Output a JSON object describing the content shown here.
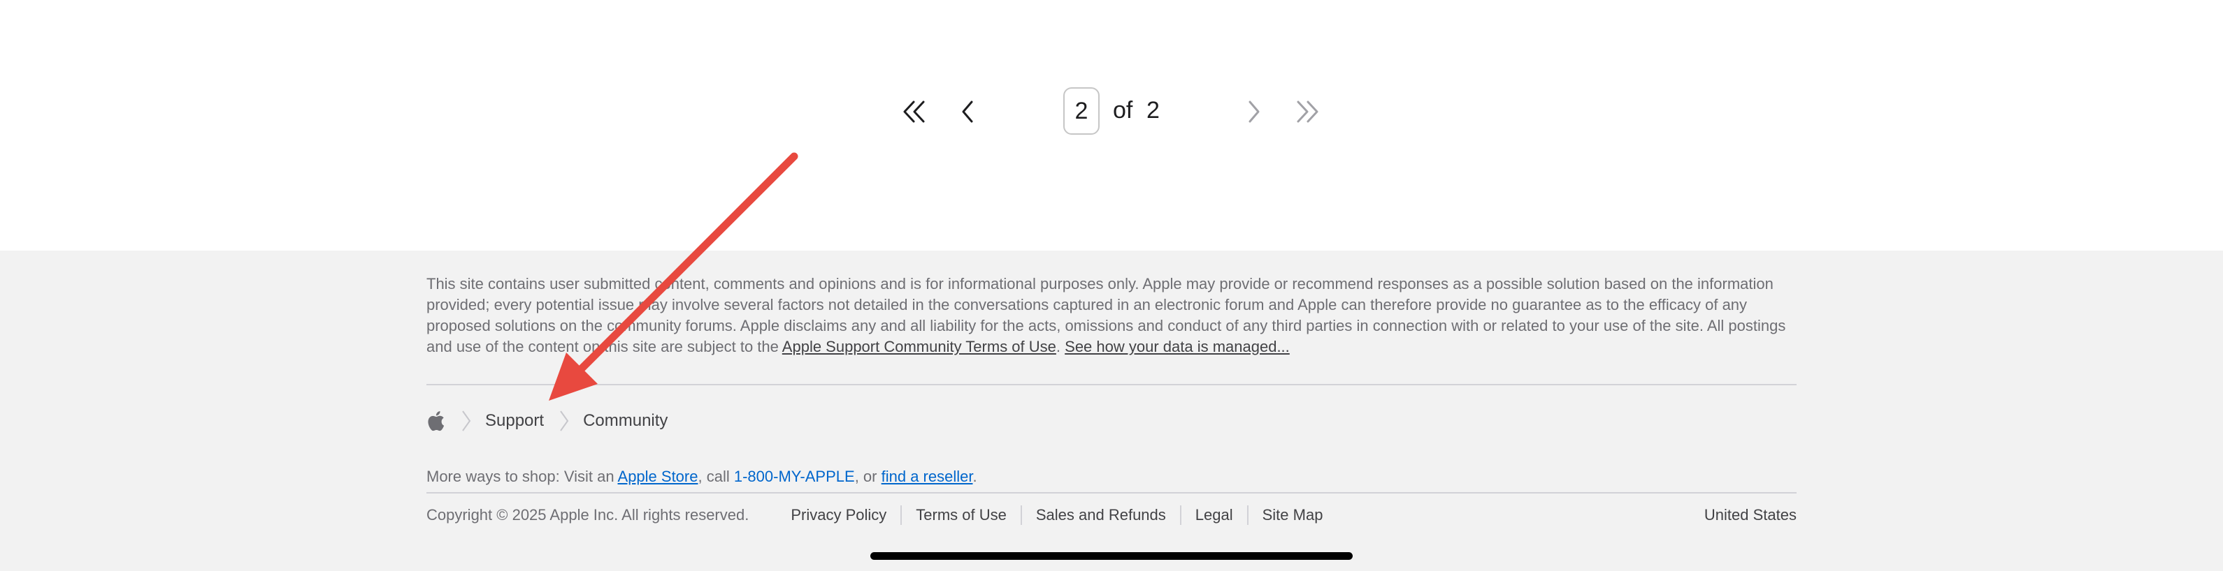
{
  "pagination": {
    "current_page": "2",
    "of_label": "of",
    "total_pages": "2",
    "first_icon": "double-chevron-left-icon",
    "prev_icon": "chevron-left-icon",
    "next_icon": "chevron-right-icon",
    "last_icon": "double-chevron-right-icon"
  },
  "footer": {
    "disclaimer_text": "This site contains user submitted content, comments and opinions and is for informational purposes only. Apple may provide or recommend responses as a possible solution based on the information provided; every potential issue may involve several factors not detailed in the conversations captured in an electronic forum and Apple can therefore provide no guarantee as to the efficacy of any proposed solutions on the community forums. Apple disclaims any and all liability for the acts, omissions and conduct of any third parties in connection with or related to your use of the site. All postings and use of the content on this site are subject to the",
    "terms_link": "Apple Support Community Terms of Use",
    "period": ".",
    "data_link": "See how your data is managed...",
    "breadcrumb": {
      "apple_icon": "apple-logo-icon",
      "separator_icon": "chevron-right-icon",
      "items": [
        "Support",
        "Community"
      ]
    },
    "shop": {
      "prefix": "More ways to shop: Visit an",
      "store_link": "Apple Store",
      "call_text": ", call",
      "phone": "1-800-MY-APPLE",
      "or_text": ", or",
      "reseller_link": "find a reseller",
      "suffix": "."
    },
    "copyright": "Copyright © 2025 Apple Inc. All rights reserved.",
    "legal_links": [
      "Privacy Policy",
      "Terms of Use",
      "Sales and Refunds",
      "Legal",
      "Site Map"
    ],
    "country": "United States"
  },
  "annotation": {
    "arrow_color": "#e8493f"
  },
  "colors": {
    "footer_bg": "#f2f2f2",
    "link_blue": "#0066cc",
    "text_gray": "#6e6e73",
    "text_dark": "#424245"
  }
}
